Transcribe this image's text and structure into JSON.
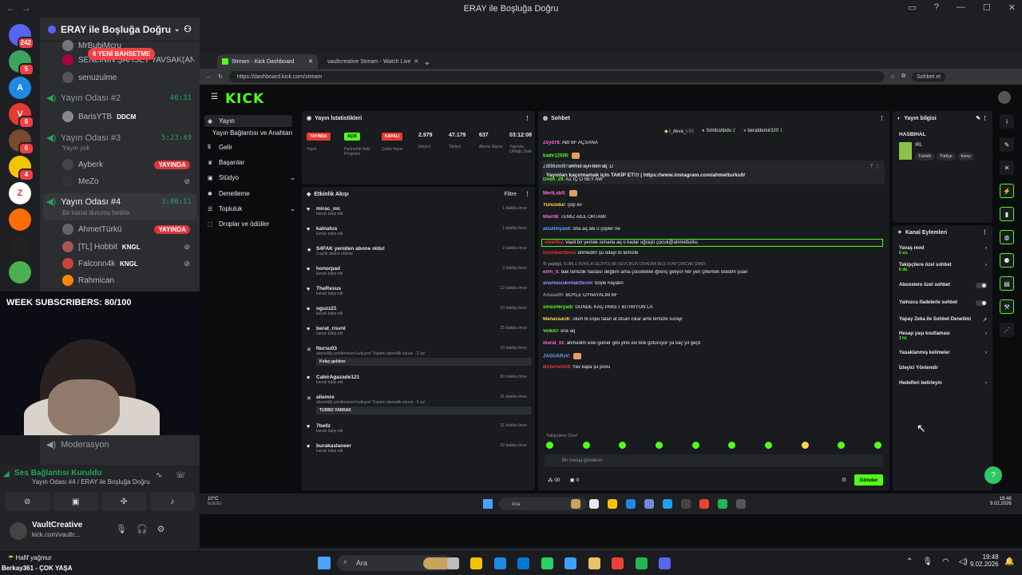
{
  "window": {
    "title": "ERAY ile Boşluğa Doğru"
  },
  "servers": [
    {
      "label": "",
      "badge": "242",
      "color": "#5865f2"
    },
    {
      "label": "",
      "badge": "5",
      "color": "#3ba55c"
    },
    {
      "label": "A",
      "badge": "",
      "color": "#1e88e5"
    },
    {
      "label": "V",
      "badge": "9",
      "color": "#e53935"
    },
    {
      "label": "",
      "badge": "6",
      "color": "#7a4a30"
    },
    {
      "label": "",
      "badge": "4",
      "color": "#f5c400"
    },
    {
      "label": "Z",
      "badge": "",
      "color": "#ffffff"
    },
    {
      "label": "",
      "badge": "",
      "color": "#ff6d00"
    },
    {
      "label": "",
      "badge": "",
      "color": "#222222"
    },
    {
      "label": "",
      "badge": "",
      "color": "#4caf50"
    }
  ],
  "sidebar": {
    "server_name": "ERAY ile Boşluğa Doğru",
    "new_mentions": "6 YENİ BAHSETME",
    "top_users": [
      "MrBubiMcru",
      "SENLİNİN ŞAHSET YAVSAK(ANI...",
      "senuzulme"
    ],
    "channels": [
      {
        "name": "Yayın Odası #2",
        "timer": "46:31",
        "status": "",
        "users": [
          {
            "name": "BarisYTB",
            "tag": "DDCM",
            "live": ""
          }
        ]
      },
      {
        "name": "Yayın Odası #3",
        "timer": "5:23:49",
        "status": "Yayın yok",
        "users": [
          {
            "name": "Ayberk",
            "tag": "",
            "live": "YAYINDA"
          },
          {
            "name": "MeZo",
            "tag": "",
            "live": ""
          }
        ]
      },
      {
        "name": "Yayın Odası #4",
        "timer": "3:00:11",
        "status": "Bir kanal durumu belirle",
        "users": [
          {
            "name": "AhmetTürkü",
            "tag": "",
            "live": "YAYINDA"
          },
          {
            "name": "[TL] Hobbit",
            "tag": "KNGL",
            "live": ""
          },
          {
            "name": "Falconn4k",
            "tag": "KNGL",
            "live": ""
          },
          {
            "name": "Rahmican",
            "tag": "",
            "live": ""
          }
        ]
      }
    ],
    "moderation": "Moderasyon"
  },
  "overlay": {
    "week_subscribers": "WEEK SUBSCRIBERS: 80/100"
  },
  "voice": {
    "status": "Ses Bağlantısı Kuruldu",
    "room": "Yayın Odası #4 / ERAY ile Boşluğa Doğru",
    "user": "VaultCreative",
    "user_sub": "kick.com/vaultc..."
  },
  "browser": {
    "tabs": [
      "Stream - Kick Dashboard",
      "vaultcreative Stream - Watch Live"
    ],
    "url": "https://dashboard.kick.com/stream",
    "chat_btn": "Sohbet et"
  },
  "kick": {
    "logo": "KICK",
    "nav": [
      "Yayın",
      "Yayın Bağlantısı ve Anahtarı",
      "Gelir",
      "Başarılar",
      "Stüdyo",
      "Denetleme",
      "Topluluk",
      "Droplar ve ödüller"
    ],
    "stats": {
      "title": "Yayın İstatistikleri",
      "tags": [
        {
          "label": "YAYINDA",
          "sub": "Yayın",
          "color": "#e53935"
        },
        {
          "label": "AÇIK",
          "sub": "Partnerlik Gelir Programı",
          "color": "#53fc18"
        },
        {
          "label": "KAPALI",
          "sub": "Çoklu Yayın",
          "color": "#e53935"
        }
      ],
      "values": [
        {
          "value": "2.979",
          "label": "İzleyici"
        },
        {
          "value": "47.179",
          "label": "Takipçi"
        },
        {
          "value": "637",
          "label": "Abone Sayısı"
        },
        {
          "value": "03:12:08",
          "label": "Yayında Olduğu Süre"
        }
      ]
    },
    "activity": {
      "title": "Etkinlik Akışı",
      "filter": "Filtre",
      "items": [
        {
          "name": "mirac_mc",
          "sub": "kanalı takip etti",
          "time": "1 dakika önce",
          "icon": "heart",
          "box": ""
        },
        {
          "name": "kalnatus",
          "sub": "kanalı takip etti",
          "time": "1 dakika önce",
          "icon": "heart",
          "box": ""
        },
        {
          "name": "S4FAK yeniden abone oldu!",
          "sub": "3 aylık abone oldular",
          "time": "2 dakika önce",
          "icon": "star",
          "box": ""
        },
        {
          "name": "honorpad",
          "sub": "kanalı takip etti",
          "time": "2 dakika önce",
          "icon": "heart",
          "box": ""
        },
        {
          "name": "TheRexus",
          "sub": "kanalı takip etti",
          "time": "12 dakika önce",
          "icon": "heart",
          "box": ""
        },
        {
          "name": "oguzz21",
          "sub": "kanalı takip etti",
          "time": "20 dakika önce",
          "icon": "heart",
          "box": ""
        },
        {
          "name": "berat_risvnl",
          "sub": "kanalı takip etti",
          "time": "25 dakika önce",
          "icon": "heart",
          "box": ""
        },
        {
          "name": "Nursu03",
          "sub": "aboneliği yenilemesini kutluyor! Toplam abonelik süresi - 2 ay!",
          "time": "26 dakika önce",
          "icon": "x",
          "box": "Kolay gelsinn"
        },
        {
          "name": "CabirAgazade121",
          "sub": "kanalı takip etti",
          "time": "30 dakika önce",
          "icon": "heart",
          "box": ""
        },
        {
          "name": "aliemre",
          "sub": "aboneliği yenilemesini kutluyor! Toplam abonelik süresi - 6 ay!",
          "time": "31 dakika önce",
          "icon": "x",
          "box": "TURBO YARRAK"
        },
        {
          "name": "7bellz",
          "sub": "kanalı takip etti",
          "time": "31 dakika önce",
          "icon": "heart",
          "box": ""
        },
        {
          "name": "burakaslaneer",
          "sub": "kanalı takip etti",
          "time": "32 dakika önce",
          "icon": "heart",
          "box": ""
        }
      ]
    },
    "chat": {
      "title": "Sohbet",
      "top": [
        {
          "name": "i_deva_i",
          "count": "50"
        },
        {
          "name": "SimitciAbdu",
          "count": "2"
        },
        {
          "name": "beratdemir320",
          "count": "1"
        }
      ],
      "pinned_by": "tarafından sabitlendi",
      "pinned_user": "@Muran0",
      "pinned_msg": "Yayınları kaçırmamak için TAKİP ET!!! | https://www.instagram.com/ahmetturku0/",
      "lines": [
        {
          "user": "Zeyd76",
          "msg": "ABİ BF AÇSANA",
          "color": "#ff6bd6"
        },
        {
          "user": "kadir12506",
          "msg": "",
          "color": "#53fc18"
        },
        {
          "user": "Zie353539",
          "msg": "ahmet ayrı ben aq :D",
          "color": "#a78bfa"
        },
        {
          "user": "Dodo_29",
          "msg": "AZ İÇ O NEY AW",
          "color": "#53fc18"
        },
        {
          "user": "MertLabX",
          "msg": "",
          "color": "#ff6bd6"
        },
        {
          "user": "Yunusdur",
          "msg": "çöp ev",
          "color": "#ffd54f"
        },
        {
          "user": "Mier08",
          "msg": "TEMİZ AİLE ORTAMI",
          "color": "#ff6bd6"
        },
        {
          "user": "alsullmya58",
          "msg": "oha aq abi o çöpler ne",
          "color": "#60a5fa"
        },
        {
          "user": "viskifitu",
          "msg": "Vault bir yemek ısmarla aq o kadar uğraştı çocuk@ahmetturku",
          "color": "#e53935"
        },
        {
          "user": "Elvinlbarbboo",
          "msg": "ahmedim şu odayı bi temizle",
          "color": "#e53935"
        },
        {
          "user": "Tr yaşlıg1",
          "msg": "KUMLU ATAKLA GEZİYOLAR SEVCİKUN ODADAN BİLE KUM ÇIKICAK ŞİMDİ",
          "color": "#8b8f96"
        },
        {
          "user": "elifn_ti",
          "msg": "bak temizlik hastası değilim ama çocokkkkk iğrenç geliyor her yeri çiflemek istedim şuan",
          "color": "#ff6bd6"
        },
        {
          "user": "anantasiskinfaktterim",
          "msg": "böyle hayatın",
          "color": "#a78bfa"
        },
        {
          "user": "Ariasa00",
          "msg": "BOYLE OYNAYALIM BF",
          "color": "#8b8f96"
        },
        {
          "user": "sinsinferyadi",
          "msg": "GÜNDE KAÇ PAKET BİTİRİYON LA",
          "color": "#53fc18"
        },
        {
          "user": "ManassaUK",
          "msg": "olum bi copu falan at disari cikar amk temizle surayi",
          "color": "#ffd54f"
        },
        {
          "user": "VolkiO",
          "msg": "one aq",
          "color": "#53fc18"
        },
        {
          "user": "murat_0z",
          "msg": "ahmedim eski günler gibi yine evi bok götürüyor ya kaç yıl geçti",
          "color": "#ff6bd6"
        },
        {
          "user": "JAGUARxV",
          "msg": "",
          "color": "#60a5fa"
        },
        {
          "user": "BirbirneS09",
          "msg": "Yav kapa şu povu",
          "color": "#e53935"
        }
      ],
      "follower_only": "Takipçilere Özel",
      "placeholder": "Bir mesaj gönderin",
      "viewers": "00",
      "points": "0",
      "send": "Gönder"
    },
    "info": {
      "title": "Yayın bilgisi",
      "stream_title": "HASBIHAL",
      "category": "IRL",
      "tags": [
        "Turkish",
        "Türkçe",
        "funny"
      ]
    },
    "actions": {
      "title": "Kanal Eylemleri",
      "items": [
        {
          "label": "Yavaş mod",
          "sub": "6 sn.",
          "kind": "chev"
        },
        {
          "label": "Takipçilere özel sohbet",
          "sub": "6 dk.",
          "kind": "chev"
        },
        {
          "label": "Abonelere özel sohbet",
          "sub": "",
          "kind": "toggle"
        },
        {
          "label": "Yalnızca ifadelerle sohbet",
          "sub": "",
          "kind": "toggle"
        },
        {
          "label": "Yapay Zeka ile Sohbet Denetimi",
          "sub": "",
          "kind": "ext"
        },
        {
          "label": "Hesap yaşı kısıtlaması",
          "sub": "1 hf.",
          "kind": "chev"
        },
        {
          "label": "Yasaklanmış kelimeler",
          "sub": "",
          "kind": "chev"
        },
        {
          "label": "İzleyici Yönlendir",
          "sub": "",
          "kind": "none"
        },
        {
          "label": "Hedefleri belirleyin",
          "sub": "",
          "kind": "chev"
        }
      ]
    },
    "inner_taskbar": {
      "weather_temp": "10°C",
      "weather_desc": "bulutlu",
      "search": "Ara",
      "time": "19:48",
      "date": "9.02.2026"
    }
  },
  "taskbar": {
    "weather": "Hafif yağmur",
    "ticker": "Berkay361 - ÇOK YAŞA",
    "search": "Ara",
    "time": "19:48",
    "date": "9.02.2026"
  }
}
